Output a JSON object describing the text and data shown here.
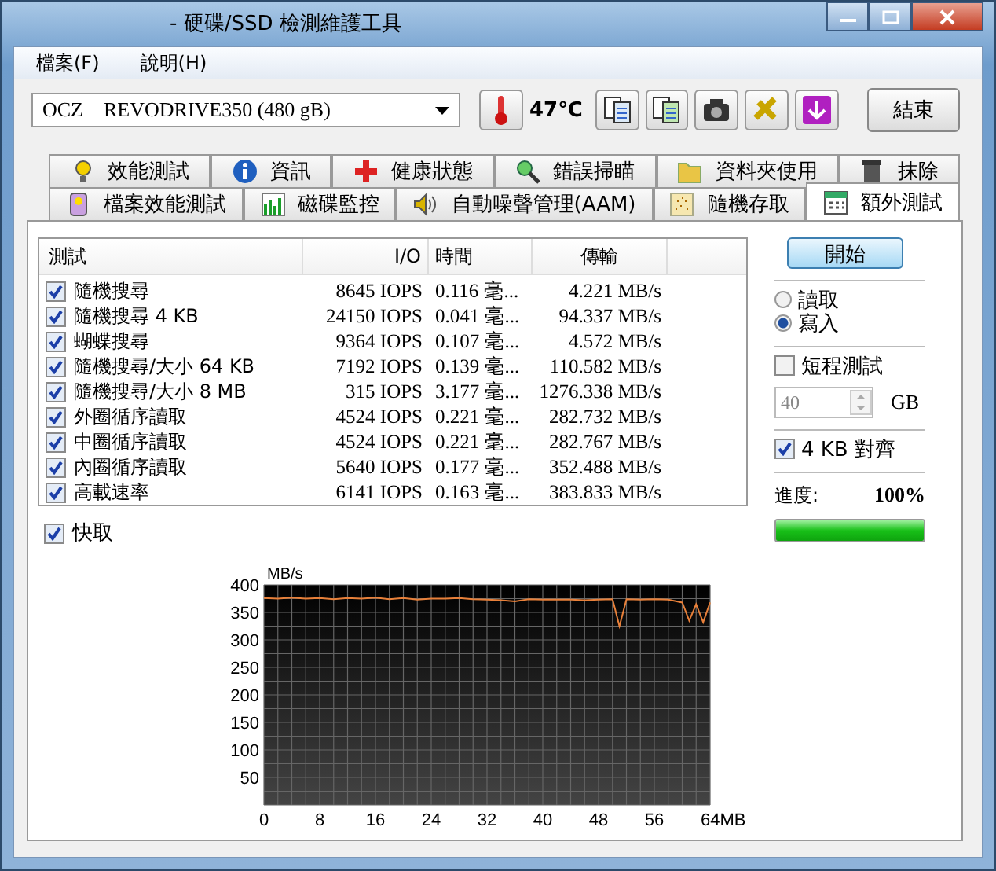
{
  "window": {
    "title": "- 硬碟/SSD 檢測維護工具"
  },
  "menu": [
    {
      "label": "檔案(F)"
    },
    {
      "label": "說明(H)"
    }
  ],
  "toolbar": {
    "drive": "OCZ    REVODRIVE350 (480 gB)",
    "temperature": "47℃",
    "buttons": [
      {
        "kind": "copy"
      },
      {
        "kind": "copy-green"
      },
      {
        "kind": "camera"
      },
      {
        "kind": "tools"
      },
      {
        "kind": "download"
      }
    ],
    "exit": "結束"
  },
  "tabs": [
    [
      {
        "label": "效能測試",
        "selected": false
      },
      {
        "label": "資訊",
        "selected": false
      },
      {
        "label": "健康狀態",
        "selected": false
      },
      {
        "label": "錯誤掃瞄",
        "selected": false
      },
      {
        "label": "資料夾使用",
        "selected": false
      },
      {
        "label": "抹除",
        "selected": false
      }
    ],
    [
      {
        "label": "檔案效能測試",
        "selected": false
      },
      {
        "label": "磁碟監控",
        "selected": false
      },
      {
        "label": "自動噪聲管理(AAM)",
        "selected": false
      },
      {
        "label": "隨機存取",
        "selected": false
      },
      {
        "label": "額外測試",
        "selected": true
      }
    ]
  ],
  "table": {
    "columns": [
      "測試",
      "I/O",
      "時間",
      "傳輸"
    ],
    "rows": [
      {
        "checked": true,
        "cells": [
          "隨機搜尋",
          "8645 IOPS",
          "0.116 毫...",
          "4.221 MB/s"
        ]
      },
      {
        "checked": true,
        "cells": [
          "隨機搜尋 4 KB",
          "24150 IOPS",
          "0.041 毫...",
          "94.337 MB/s"
        ]
      },
      {
        "checked": true,
        "cells": [
          "蝴蝶搜尋",
          "9364 IOPS",
          "0.107 毫...",
          "4.572 MB/s"
        ]
      },
      {
        "checked": true,
        "cells": [
          "隨機搜尋/大小 64 KB",
          "7192 IOPS",
          "0.139 毫...",
          "110.582 MB/s"
        ]
      },
      {
        "checked": true,
        "cells": [
          "隨機搜尋/大小 8 MB",
          "315 IOPS",
          "3.177 毫...",
          "1276.338 MB/s"
        ]
      },
      {
        "checked": true,
        "cells": [
          "外圈循序讀取",
          "4524 IOPS",
          "0.221 毫...",
          "282.732 MB/s"
        ]
      },
      {
        "checked": true,
        "cells": [
          "中圈循序讀取",
          "4524 IOPS",
          "0.221 毫...",
          "282.767 MB/s"
        ]
      },
      {
        "checked": true,
        "cells": [
          "內圈循序讀取",
          "5640 IOPS",
          "0.177 毫...",
          "352.488 MB/s"
        ]
      },
      {
        "checked": true,
        "cells": [
          "高載速率",
          "6141 IOPS",
          "0.163 毫...",
          "383.833 MB/s"
        ]
      }
    ]
  },
  "cache": {
    "label": "快取",
    "checked": true
  },
  "chart_data": {
    "type": "line",
    "grid": true,
    "ylabel": "MB/s",
    "xlim": [
      0,
      64
    ],
    "ylim": [
      0,
      400
    ],
    "xticks": [
      0,
      8,
      16,
      24,
      32,
      40,
      48,
      56,
      {
        "value": 64,
        "label": "64MB"
      }
    ],
    "yticks": [
      50,
      100,
      150,
      200,
      250,
      300,
      350,
      400
    ],
    "x": [
      0,
      2,
      4,
      6,
      8,
      10,
      12,
      14,
      16,
      18,
      20,
      22,
      24,
      26,
      28,
      30,
      32,
      34,
      36,
      38,
      40,
      42,
      44,
      46,
      48,
      50,
      51,
      52,
      54,
      56,
      58,
      60,
      61,
      62,
      63,
      64
    ],
    "series": [
      {
        "color": "#e8803a",
        "values": [
          376,
          375,
          377,
          375,
          376,
          374,
          376,
          375,
          377,
          374,
          376,
          373,
          375,
          375,
          376,
          374,
          373,
          372,
          370,
          374,
          373,
          373,
          373,
          372,
          373,
          374,
          325,
          374,
          373,
          374,
          373,
          368,
          335,
          365,
          332,
          368
        ]
      }
    ]
  },
  "side": {
    "start": "開始",
    "modes": [
      {
        "label": "讀取",
        "selected": false
      },
      {
        "label": "寫入",
        "selected": true
      }
    ],
    "short_test": {
      "label": "短程測試",
      "checked": false
    },
    "size": {
      "value": "40",
      "unit": "GB",
      "disabled": true
    },
    "align": {
      "label": "4 KB 對齊",
      "checked": true
    },
    "progress": {
      "label": "進度:",
      "reading": "100%",
      "level": 1
    }
  }
}
